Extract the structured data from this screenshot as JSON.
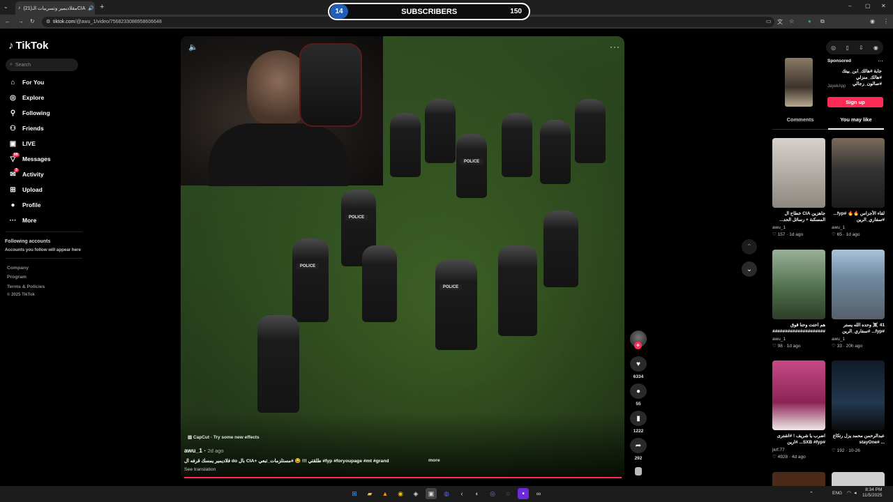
{
  "browser": {
    "tab_title": "(21)مقلاديمير وتسريبات الـCIA",
    "url_domain": "tiktok.com",
    "url_path": "/@awu_1/video/7568233088958606648",
    "icons": [
      "chevron-down-icon",
      "tiktok-icon",
      "speaker-icon",
      "close-icon",
      "plus-icon",
      "back-icon",
      "forward-icon",
      "reload-icon",
      "site-info-icon",
      "install-icon",
      "translate-icon",
      "star-icon",
      "extensions-icon",
      "profile-icon",
      "menu-icon"
    ]
  },
  "overlay": {
    "goal_current": "14",
    "label": "SUBSCRIBERS",
    "goal_target": "150"
  },
  "sidebar": {
    "logo": "TikTok",
    "search_placeholder": "Search",
    "nav": [
      {
        "label": "For You",
        "icon": "home-icon"
      },
      {
        "label": "Explore",
        "icon": "compass-icon"
      },
      {
        "label": "Following",
        "icon": "user-follow-icon"
      },
      {
        "label": "Friends",
        "icon": "friends-icon"
      },
      {
        "label": "LIVE",
        "icon": "live-icon"
      },
      {
        "label": "Messages",
        "icon": "messages-icon",
        "badge": "99"
      },
      {
        "label": "Activity",
        "icon": "activity-icon",
        "badge": "3"
      },
      {
        "label": "Upload",
        "icon": "upload-icon"
      },
      {
        "label": "Profile",
        "icon": "profile-avatar-icon"
      },
      {
        "label": "More",
        "icon": "more-icon"
      }
    ],
    "following_title": "Following accounts",
    "following_desc": "Accounts you follow will appear here",
    "footer": [
      "Company",
      "Program",
      "Terms & Policies",
      "© 2025 TikTok"
    ]
  },
  "video": {
    "capcut": "CapCut · Try some new effects",
    "author": "awu_1",
    "posted": "2d ago",
    "caption": "فلاديمير يمسك قرفه ال do بال CIA+ طلقتي !!! 😂 #مستلزمات_تبعي #fyp #foryoupage #mt #grand",
    "more": "more",
    "see_translation": "See translation",
    "plate_text": "POLICE"
  },
  "actions": {
    "likes": "6334",
    "comments": "55",
    "saves": "1222",
    "shares": "292"
  },
  "right_panel": {
    "sponsored": "Sponsored",
    "ad_title": "جابة #هالك_ابن_بيتك #هالك_منزلي #صالون_رجالي",
    "ad_brand": "JayekApp",
    "signup": "Sign up",
    "tab_comments": "Comments",
    "tab_you_may_like": "You may like",
    "cards": [
      {
        "title": "جاهزين CIA خطاح ال المسكنة + رسائل الحد...",
        "author": "awu_1",
        "stats": "♡ 157 · 1d ago",
        "color": "#c9c3bd"
      },
      {
        "title": "لقاء الأجزاس 🔥🔥 #fyp... #سفاري_الرين",
        "author": "awu_1",
        "stats": "♡ 65 · 1d ago",
        "color": "#3a3a3a"
      },
      {
        "title": "هم احتت وحنا قوق ########################",
        "author": "awu_1",
        "stats": "♡ 98 · 1d ago",
        "color": "#5a7a55"
      },
      {
        "title": "41 ☠️ وحده الله يستر #fyp... #سفاري_الرين",
        "author": "awu_1",
        "stats": "♡ 33 · 20h ago",
        "color": "#8aa0b4"
      },
      {
        "title": "اضرب يا شريف ! #اشترى #SXB #fyp... #ارين",
        "author": "jkrf.77",
        "stats": "♡ 4928 · 4d ago",
        "color": "#b0356f"
      },
      {
        "title": "عبدالرحمن محمد يزل رتكاع ... #stayOne",
        "author": "",
        "stats": "♡ 192 · 10-26",
        "color": "#1c2a3a"
      }
    ]
  },
  "taskbar": {
    "lang": "ENG",
    "time": "8:34 PM",
    "date": "11/5/2025"
  }
}
